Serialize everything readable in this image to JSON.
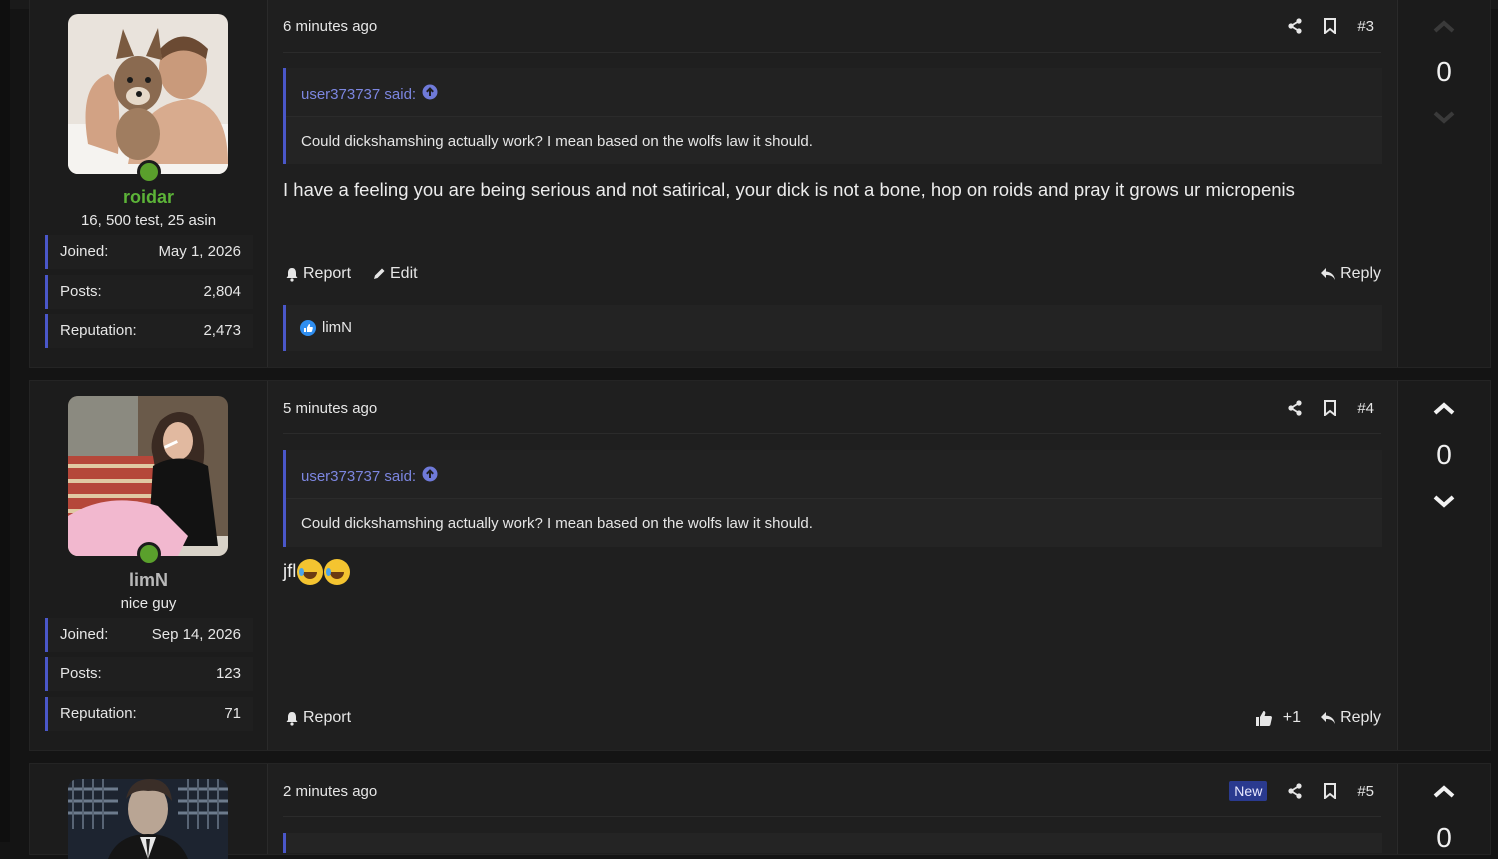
{
  "posts": [
    {
      "user": {
        "name": "roidar",
        "name_color": "#5cb338",
        "title": "16, 500 test, 25 asin",
        "stats": [
          {
            "label": "Joined:",
            "value": "May 1, 2026"
          },
          {
            "label": "Posts:",
            "value": "2,804"
          },
          {
            "label": "Reputation:",
            "value": "2,473"
          }
        ]
      },
      "time": "6 minutes ago",
      "number": "#3",
      "quote": {
        "author": "user373737 said:",
        "text": "Could dickshamshing actually work? I mean based on the wolfs law it should."
      },
      "body": "I have a feeling you are being serious and not satirical, your dick is not a bone, hop on roids and pray it grows ur micropenis",
      "actions": {
        "report": "Report",
        "edit": "Edit",
        "reply": "Reply"
      },
      "reaction_user": "limN",
      "votes": "0"
    },
    {
      "user": {
        "name": "limN",
        "name_color": "#b9b9b9",
        "title": "nice guy",
        "stats": [
          {
            "label": "Joined:",
            "value": "Sep 14, 2026"
          },
          {
            "label": "Posts:",
            "value": "123"
          },
          {
            "label": "Reputation:",
            "value": "71"
          }
        ]
      },
      "time": "5 minutes ago",
      "number": "#4",
      "quote": {
        "author": "user373737 said:",
        "text": "Could dickshamshing actually work? I mean based on the wolfs law it should."
      },
      "body": "jfl",
      "actions": {
        "report": "Report",
        "like_count": "+1",
        "reply": "Reply"
      },
      "votes": "0"
    },
    {
      "time": "2 minutes ago",
      "badge": "New",
      "number": "#5",
      "votes": "0"
    }
  ],
  "icons": {
    "share": "share-icon",
    "bookmark": "bookmark-icon",
    "up": "chevron-up-icon",
    "down": "chevron-down-icon",
    "bell": "bell-icon",
    "pencil": "pencil-icon",
    "reply": "reply-icon",
    "like": "thumbs-up-icon",
    "goto": "arrow-up-circle-icon"
  }
}
